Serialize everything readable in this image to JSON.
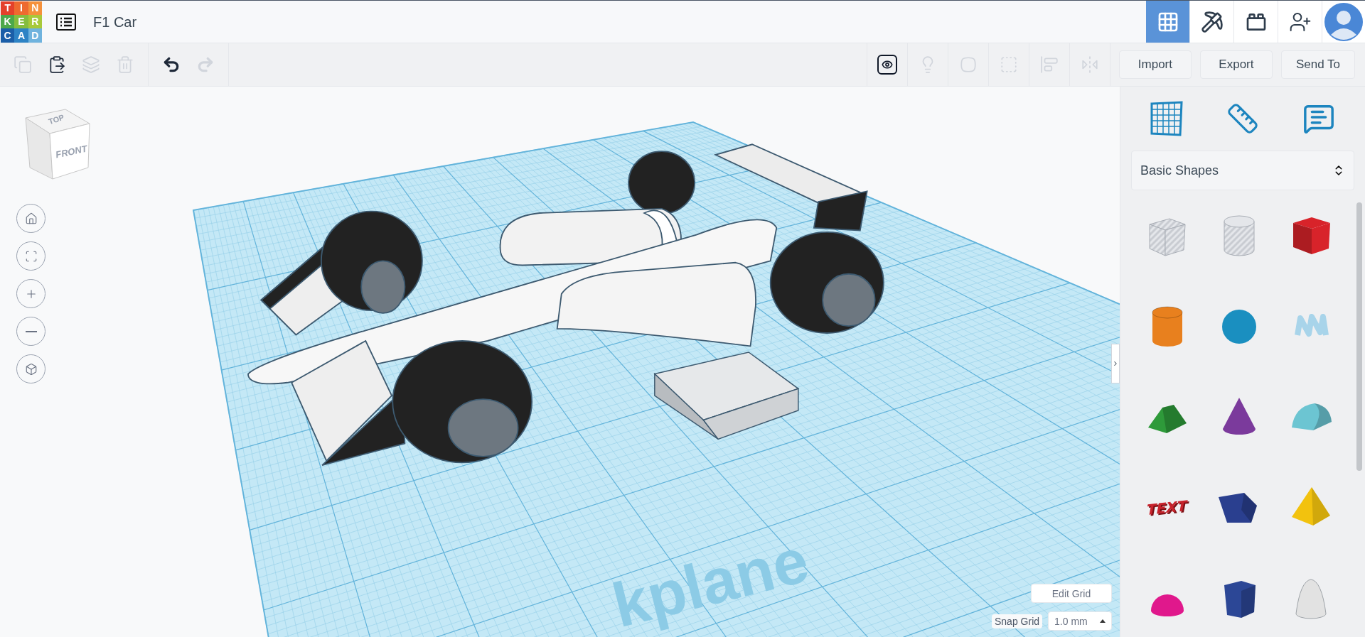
{
  "header": {
    "logo_letters": [
      "T",
      "I",
      "N",
      "K",
      "E",
      "R",
      "C",
      "A",
      "D"
    ],
    "title": "F1 Car",
    "views": [
      {
        "kind": "grid",
        "selected": true
      },
      {
        "kind": "pickaxe",
        "selected": false
      },
      {
        "kind": "brick",
        "selected": false
      }
    ]
  },
  "toolbar": {
    "edit_tools": [
      {
        "kind": "copy",
        "disabled": true
      },
      {
        "kind": "paste",
        "disabled": false
      },
      {
        "kind": "duplicate",
        "disabled": true
      },
      {
        "kind": "delete",
        "disabled": true
      }
    ],
    "history": [
      {
        "kind": "undo",
        "disabled": false
      },
      {
        "kind": "redo",
        "disabled": true
      }
    ],
    "view_tools": [
      {
        "kind": "notes",
        "disabled": false
      },
      {
        "kind": "light",
        "disabled": true
      },
      {
        "kind": "group",
        "disabled": true
      },
      {
        "kind": "ungroup",
        "disabled": true
      },
      {
        "kind": "align",
        "disabled": true
      },
      {
        "kind": "mirror",
        "disabled": true
      }
    ],
    "buttons": [
      "Import",
      "Export",
      "Send To"
    ]
  },
  "view_cube": {
    "top": "TOP",
    "front": "FRONT"
  },
  "workplane": {
    "label": "kplane"
  },
  "grid_controls": {
    "edit_button": "Edit Grid",
    "snap_label": "Snap Grid",
    "snap_value": "1.0 mm"
  },
  "panel": {
    "category": "Basic Shapes",
    "shapes": [
      {
        "kind": "box-hole"
      },
      {
        "kind": "cylinder-hole"
      },
      {
        "kind": "box",
        "color": "#d8232a"
      },
      {
        "kind": "cylinder",
        "color": "#e8801e"
      },
      {
        "kind": "sphere",
        "color": "#1a8fc0"
      },
      {
        "kind": "scribble",
        "color": "#a8d4ea"
      },
      {
        "kind": "roof",
        "color": "#2e9a3a"
      },
      {
        "kind": "cone",
        "color": "#7b3a9c"
      },
      {
        "kind": "round-roof",
        "color": "#6cc5d2"
      },
      {
        "kind": "text",
        "label": "TEXT",
        "color": "#c8232c"
      },
      {
        "kind": "prism",
        "color": "#2a3f8f"
      },
      {
        "kind": "pyramid",
        "color": "#f2c20e"
      },
      {
        "kind": "half-sphere",
        "color": "#e0188c"
      },
      {
        "kind": "polygon",
        "color": "#2c4796"
      },
      {
        "kind": "paraboloid",
        "color": "#e2e2e2"
      }
    ]
  }
}
